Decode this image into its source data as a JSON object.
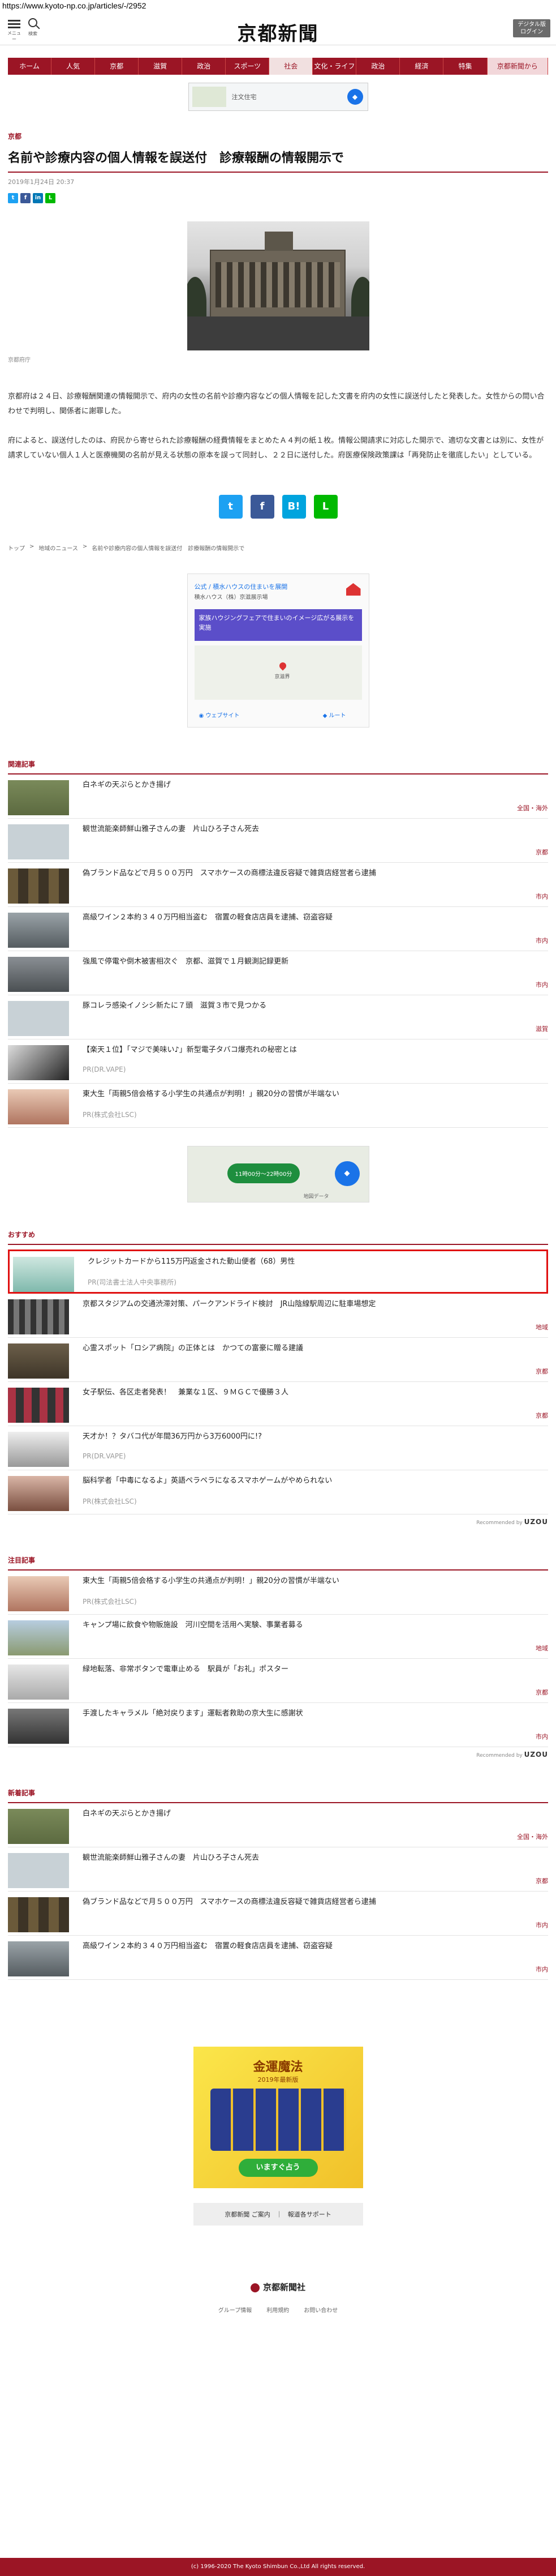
{
  "url": "https://www.kyoto-np.co.jp/articles/-/2952",
  "header": {
    "menu_label": "メニュー",
    "search_label": "検索",
    "logo": "京都新聞",
    "login_label_1": "デジタル版",
    "login_label_2": "ログイン"
  },
  "nav": [
    "ホーム",
    "人気",
    "京都",
    "滋賀",
    "政治",
    "スポーツ",
    "社会",
    "文化・ライフ",
    "政治",
    "経済",
    "特集",
    "京都新聞から"
  ],
  "ad_top": {
    "label": "注文住宅",
    "btn": "◆"
  },
  "article": {
    "section": "京都",
    "title": "名前や診療内容の個人情報を誤送付　診療報酬の情報開示で",
    "date": "2019年1月24日 20:37",
    "caption": "京都府庁",
    "paragraphs": [
      "京都府は２４日、診療報酬関連の情報開示で、府内の女性の名前や診療内容などの個人情報を記した文書を府内の女性に誤送付したと発表した。女性からの問い合わせで判明し、関係者に謝罪した。",
      "府によると、誤送付したのは、府民から寄せられた診療報酬の経費情報をまとめたＡ４判の紙１枚。情報公開請求に対応した開示で、適切な文書とは別に、女性が請求していない個人１人と医療機関の名前が見える状態の原本を誤って同封し、２２日に送付した。府医療保険政策課は「再発防止を徹底したい」としている。"
    ]
  },
  "share_small": [
    "t",
    "f",
    "in",
    "L"
  ],
  "share_big": [
    "t",
    "f",
    "B!",
    "L"
  ],
  "breadcrumb": [
    "トップ",
    "地域のニュース",
    "名前や診療内容の個人情報を誤送付　診療報酬の情報開示で"
  ],
  "ad_map": {
    "head": "公式 / 積水ハウスの住まいを展開",
    "sub": "積水ハウス（株）京滋展示場",
    "banner": "家族ハウジングフェアで住まいのイメージ広がる展示を実施",
    "pin": "京滋界",
    "btn1": "ウェブサイト",
    "btn2": "ルート"
  },
  "related": {
    "heading": "関連記事",
    "items": [
      {
        "title": "白ネギの天ぷらとかき揚げ",
        "cat": "全国・海外"
      },
      {
        "title": "観世流能楽師鮮山雅子さんの妻　片山ひろ子さん死去",
        "cat": "京都"
      },
      {
        "title": "偽ブランド品などで月５００万円　スマホケースの商標法違反容疑で雑貨店経営者ら逮捕",
        "cat": "市内"
      },
      {
        "title": "高級ワイン２本約３４０万円相当盗む　宿置の軽食店店員を逮捕、窃盗容疑",
        "cat": "市内"
      },
      {
        "title": "強風で停電や倒木被害相次ぐ　京都、滋賀で１月観測記録更新",
        "cat": "市内"
      },
      {
        "title": "豚コレラ感染イノシシ新たに７頭　滋賀３市で見つかる",
        "cat": "滋賀"
      },
      {
        "title": "【楽天１位】「マジで美味い♪」新型電子タバコ爆売れの秘密とは",
        "sub": "PR(DR.VAPE)"
      },
      {
        "title": "東大生「両親5倍会格する小学生の共通点が判明！」親20分の習慣が半端ない",
        "sub": "PR(株式会社LSC)"
      }
    ]
  },
  "ad_mid": {
    "btn": "11時00分〜22時00分",
    "label": "地図データ"
  },
  "recommend": {
    "heading": "おすすめ",
    "items": [
      {
        "title": "クレジットカードから115万円返金された動山便者（68）男性",
        "sub": "PR(司法書士法人中央事務所)"
      },
      {
        "title": "京都スタジアムの交通渋滞対策、パークアンドライド検討　JR山陰線駅周辺に駐車場想定",
        "cat": "地域"
      },
      {
        "title": "心霊スポット「ロシア病院」の正体とは　かつての富豪に贈る建議",
        "cat": "京都"
      },
      {
        "title": "女子駅伝、各区走者発表！　兼業な１区、９ＭＧＣで優勝３人",
        "cat": "京都"
      },
      {
        "title": "天才か！？タバコ代が年間36万円から3万6000円に!?",
        "sub": "PR(DR.VAPE)"
      },
      {
        "title": "脳科学者「中毒になるよ」英語ペラペラになるスマホゲームがやめられない",
        "sub": "PR(株式会社LSC)"
      }
    ],
    "credit": "Recommended by",
    "brand": "UZOU"
  },
  "attention": {
    "heading": "注目記事",
    "items": [
      {
        "title": "東大生「両親5倍会格する小学生の共通点が判明！」親20分の習慣が半端ない",
        "sub": "PR(株式会社LSC)"
      },
      {
        "title": "キャンプ場に飲食や物販施設　河川空間を活用へ実験、事業者募る",
        "cat": "地域"
      },
      {
        "title": "緑地転落、非常ボタンで電車止める　駅員が「お礼」ポスター",
        "cat": "京都"
      },
      {
        "title": "手渡したキャラメル「絶対戻ります」運転者救助の京大生に感謝状",
        "cat": "市内"
      }
    ],
    "credit": "Recommended by",
    "brand": "UZOU"
  },
  "latest": {
    "heading": "新着記事",
    "items": [
      {
        "title": "白ネギの天ぷらとかき揚げ",
        "cat": "全国・海外"
      },
      {
        "title": "観世流能楽師鮮山雅子さんの妻　片山ひろ子さん死去",
        "cat": "京都"
      },
      {
        "title": "偽ブランド品などで月５００万円　スマホケースの商標法違反容疑で雑貨店経営者ら逮捕",
        "cat": "市内"
      },
      {
        "title": "高級ワイン２本約３４０万円相当盗む　宿置の軽食店店員を逮捕、窃盗容疑",
        "cat": "市内"
      }
    ]
  },
  "ad_sq": {
    "title": "金運魔法",
    "sub": "2019年最新版",
    "btn": "いますぐ占う"
  },
  "footer": {
    "links": [
      "京都新聞 ご案内",
      "｜",
      "報道各サポート"
    ],
    "logo": "京都新聞社",
    "nav": [
      "グループ情報",
      "利用規約",
      "お問い合わせ"
    ],
    "copyright": "(c) 1996-2020 The Kyoto Shimbun Co.,Ltd All rights reserved."
  },
  "colors": {
    "brand": "#9b1525",
    "highlight": "#e01010"
  }
}
